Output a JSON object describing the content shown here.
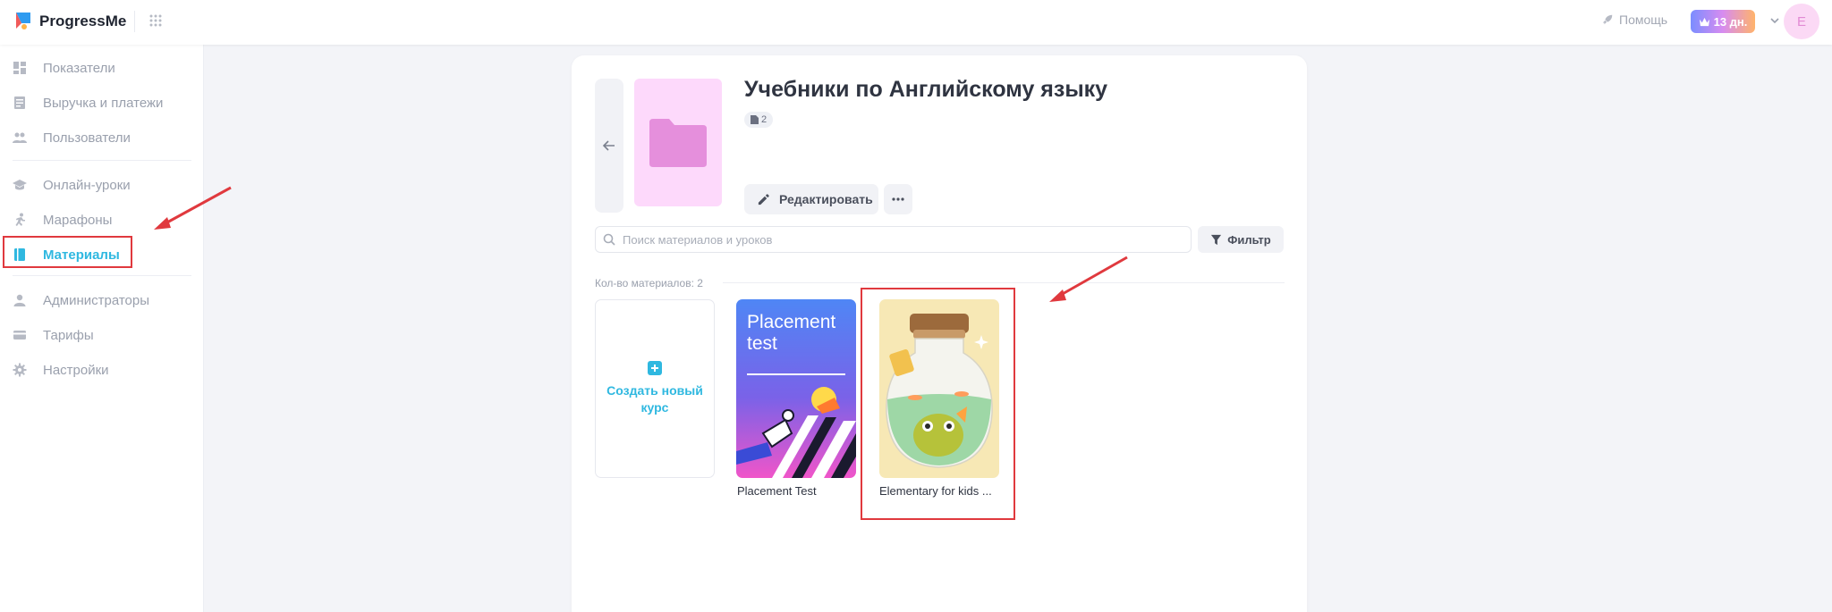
{
  "header": {
    "brand": "ProgressMe",
    "help_label": "Помощь",
    "plan_badge": "13 дн.",
    "avatar_letter": "E"
  },
  "sidebar": {
    "items": [
      {
        "label": "Показатели",
        "icon": "dashboard-icon"
      },
      {
        "label": "Выручка и платежи",
        "icon": "receipt-icon"
      },
      {
        "label": "Пользователи",
        "icon": "users-icon"
      },
      {
        "label": "Онлайн-уроки",
        "icon": "graduation-cap-icon"
      },
      {
        "label": "Марафоны",
        "icon": "running-icon"
      },
      {
        "label": "Материалы",
        "icon": "book-icon",
        "active": true
      },
      {
        "label": "Администраторы",
        "icon": "person-icon"
      },
      {
        "label": "Тарифы",
        "icon": "credit-card-icon"
      },
      {
        "label": "Настройки",
        "icon": "gear-icon"
      }
    ]
  },
  "folder": {
    "title": "Учебники по Английскому языку",
    "file_count": "2",
    "edit_label": "Редактировать"
  },
  "search": {
    "placeholder": "Поиск материалов и уроков",
    "filter_label": "Фильтр"
  },
  "materials": {
    "count_label": "Кол-во материалов: 2",
    "create_label": "Создать новый курс",
    "items": [
      {
        "title": "Placement Test",
        "cover_text": "Placement test"
      },
      {
        "title": "Elementary for kids ..."
      }
    ]
  },
  "colors": {
    "accent": "#2fb8e0",
    "annotation": "#e0393e",
    "folder_bg": "#fdd9fb",
    "folder_icon": "#e58fdc"
  }
}
